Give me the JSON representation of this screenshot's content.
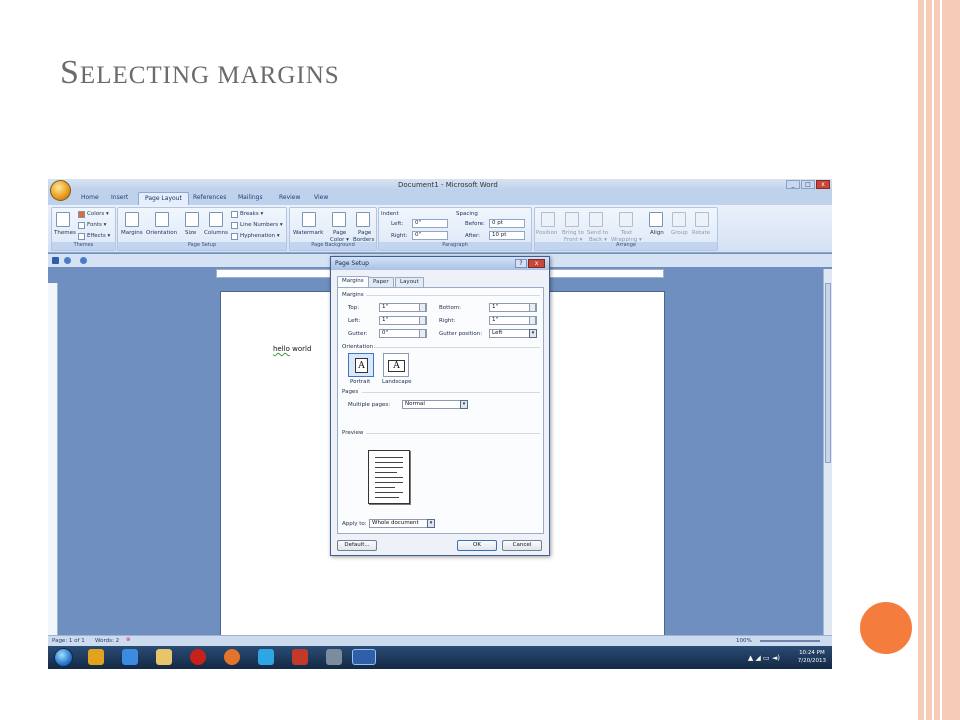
{
  "slide": {
    "title_first_letter": "S",
    "title_rest": "ELECTING MARGINS"
  },
  "window": {
    "title": "Document1 - Microsoft Word",
    "minimize": "_",
    "maximize": "□",
    "close": "x"
  },
  "ribbon_tabs": [
    "Home",
    "Insert",
    "Page Layout",
    "References",
    "Mailings",
    "Review",
    "View"
  ],
  "active_tab": "Page Layout",
  "ribbon": {
    "themes": {
      "themes_label": "Themes",
      "colors": "Colors ▾",
      "fonts": "Fonts ▾",
      "effects": "Effects ▾",
      "group": "Themes"
    },
    "page_setup": {
      "margins": "Margins",
      "orientation": "Orientation",
      "size": "Size",
      "columns": "Columns",
      "breaks": "Breaks ▾",
      "line_numbers": "Line Numbers ▾",
      "hyphenation": "Hyphenation ▾",
      "group": "Page Setup"
    },
    "page_background": {
      "watermark": "Watermark",
      "page_color_1": "Page",
      "page_color_2": "Color ▾",
      "page_borders_1": "Page",
      "page_borders_2": "Borders",
      "group": "Page Background"
    },
    "paragraph": {
      "indent_title": "Indent",
      "left_label": "Left:",
      "left_value": "0\"",
      "right_label": "Right:",
      "right_value": "0\"",
      "spacing_title": "Spacing",
      "before_label": "Before:",
      "before_value": "0 pt",
      "after_label": "After:",
      "after_value": "10 pt",
      "group": "Paragraph"
    },
    "arrange": {
      "position": "Position",
      "bring_front_1": "Bring to",
      "bring_front_2": "Front ▾",
      "send_back_1": "Send to",
      "send_back_2": "Back ▾",
      "text_wrapping_1": "Text",
      "text_wrapping_2": "Wrapping ▾",
      "align": "Align",
      "group_btn": "Group",
      "rotate": "Rotate",
      "group": "Arrange"
    }
  },
  "document": {
    "word1": "hello",
    "word2": " world"
  },
  "status": {
    "page": "Page: 1 of 1",
    "words": "Words: 2",
    "zoom": "100%"
  },
  "taskbar": {
    "time": "10:24 PM",
    "date": "7/20/2013"
  },
  "dialog": {
    "title": "Page Setup",
    "help": "?",
    "close": "x",
    "tabs": [
      "Margins",
      "Paper",
      "Layout"
    ],
    "active_tab": "Margins",
    "margins_section": "Margins",
    "top_label": "Top:",
    "top_value": "1\"",
    "bottom_label": "Bottom:",
    "bottom_value": "1\"",
    "left_label": "Left:",
    "left_value": "1\"",
    "right_label": "Right:",
    "right_value": "1\"",
    "gutter_label": "Gutter:",
    "gutter_value": "0\"",
    "gutter_pos_label": "Gutter position:",
    "gutter_pos_value": "Left",
    "orientation_section": "Orientation",
    "portrait": "Portrait",
    "landscape": "Landscape",
    "orientation_glyph": "A",
    "selected_orientation": "Portrait",
    "pages_section": "Pages",
    "multiple_pages_label": "Multiple pages:",
    "multiple_pages_value": "Normal",
    "preview_section": "Preview",
    "apply_to_label": "Apply to:",
    "apply_to_value": "Whole document",
    "default_button": "Default...",
    "ok_button": "OK",
    "cancel_button": "Cancel"
  }
}
